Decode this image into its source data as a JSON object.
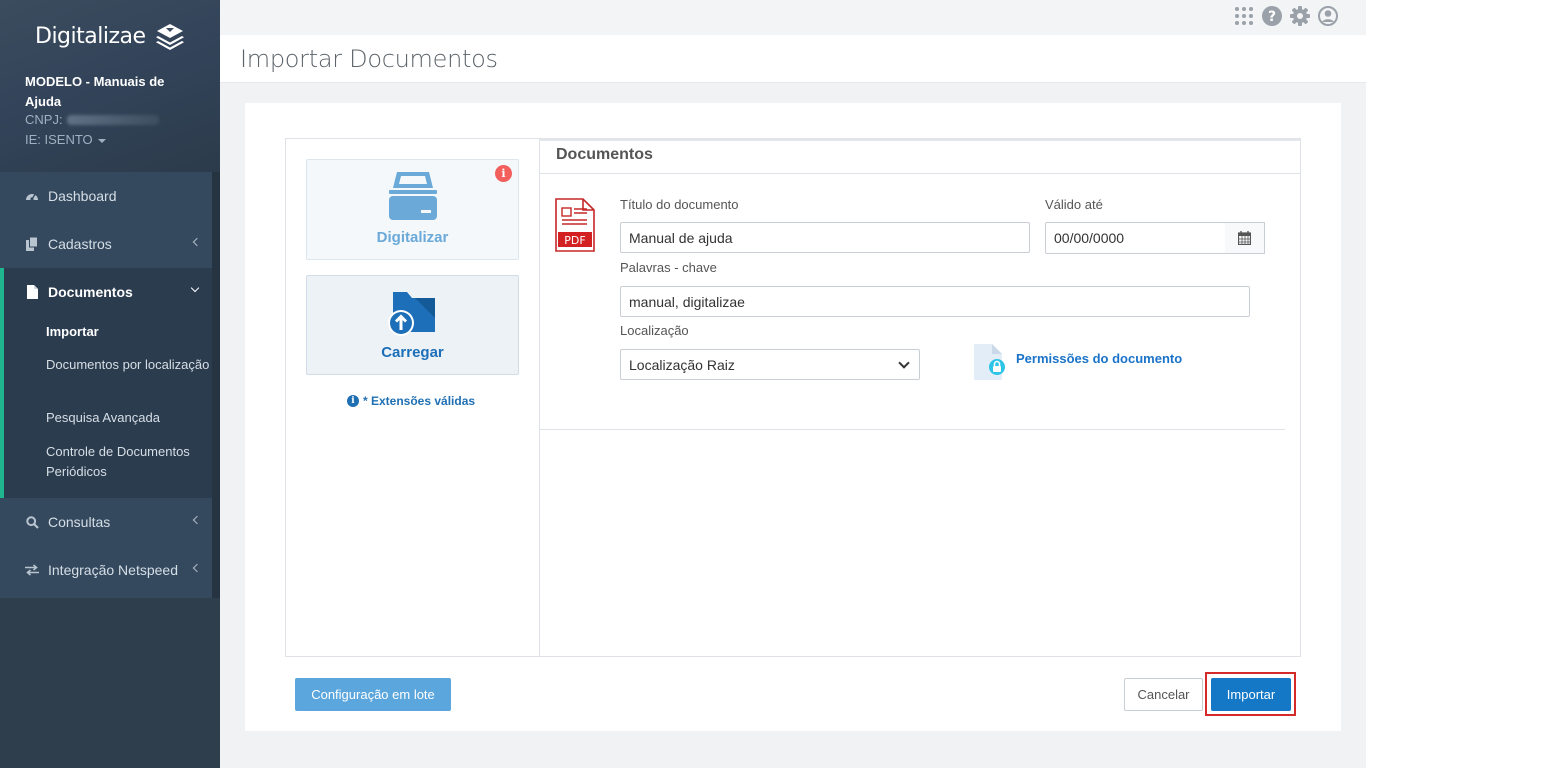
{
  "app": {
    "brand": "Digitalizae"
  },
  "company": {
    "name": "MODELO - Manuais de Ajuda",
    "cnpj_label": "CNPJ:",
    "ie": "IE: ISENTO"
  },
  "sidebar": {
    "items": [
      {
        "label": "Dashboard",
        "icon": "dashboard-icon"
      },
      {
        "label": "Cadastros",
        "icon": "copy-icon"
      },
      {
        "label": "Documentos",
        "icon": "file-icon"
      },
      {
        "label": "Consultas",
        "icon": "search-icon"
      },
      {
        "label": "Integração Netspeed",
        "icon": "exchange-icon"
      }
    ],
    "documentos_sub": [
      "Importar",
      "Documentos por localização",
      "Pesquisa Avançada",
      "Controle de Documentos Periódicos"
    ]
  },
  "topbar": {
    "icons": [
      "apps-grid-icon",
      "help-icon",
      "gear-icon",
      "user-icon"
    ]
  },
  "page": {
    "title": "Importar Documentos"
  },
  "upload": {
    "digitalizar_label": "Digitalizar",
    "carregar_label": "Carregar",
    "badge": "i",
    "extensions_link": "* Extensões válidas"
  },
  "documents": {
    "header": "Documentos",
    "file_type": "PDF",
    "title_label": "Título do documento",
    "title_value": "Manual de ajuda",
    "valid_label": "Válido até",
    "valid_value": "00/00/0000",
    "keywords_label": "Palavras - chave",
    "keywords_value": "manual, digitalizae",
    "location_label": "Localização",
    "location_value": "Localização Raiz",
    "permissions_link": "Permissões do documento"
  },
  "actions": {
    "batch_label": "Configuração em lote",
    "cancel_label": "Cancelar",
    "import_label": "Importar"
  },
  "colors": {
    "sidebar_bg": "#34495e",
    "accent_green": "#1fb58f",
    "primary_blue": "#1478c7",
    "highlight_red": "#d42a2a",
    "link_blue": "#1a73c8"
  }
}
